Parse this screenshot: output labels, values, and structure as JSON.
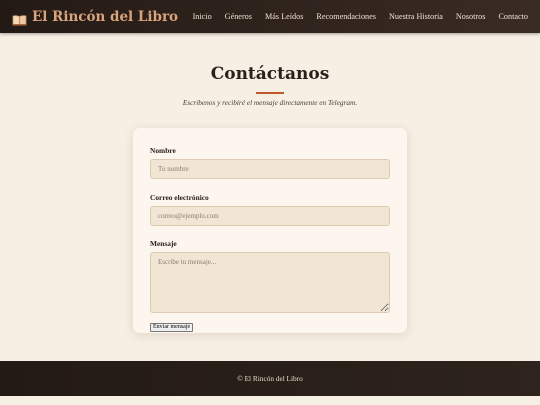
{
  "header": {
    "brand": "El Rincón del Libro",
    "brand_icon": "open-book-icon",
    "nav": [
      "Inicio",
      "Géneros",
      "Más Leídos",
      "Recomendaciones",
      "Nuestra Historia",
      "Nosotros",
      "Contacto"
    ]
  },
  "main": {
    "title": "Contáctanos",
    "subtitle": "Escríbenos y recibiré el mensaje directamente en Telegram."
  },
  "form": {
    "name_label": "Nombre",
    "name_placeholder": "Tu nombre",
    "email_label": "Correo electrónico",
    "email_placeholder": "correo@ejemplo.com",
    "message_label": "Mensaje",
    "message_placeholder": "Escribe tu mensaje...",
    "submit_label": "Enviar mensaje"
  },
  "footer": {
    "text": "© El Rincón del Libro"
  },
  "colors": {
    "header_bg": "#241a15",
    "brand": "#d9a37c",
    "accent": "#c2562e",
    "page_bg": "#f6efe3",
    "card_bg": "#fcf6ee",
    "input_bg": "#f1e6d4"
  }
}
